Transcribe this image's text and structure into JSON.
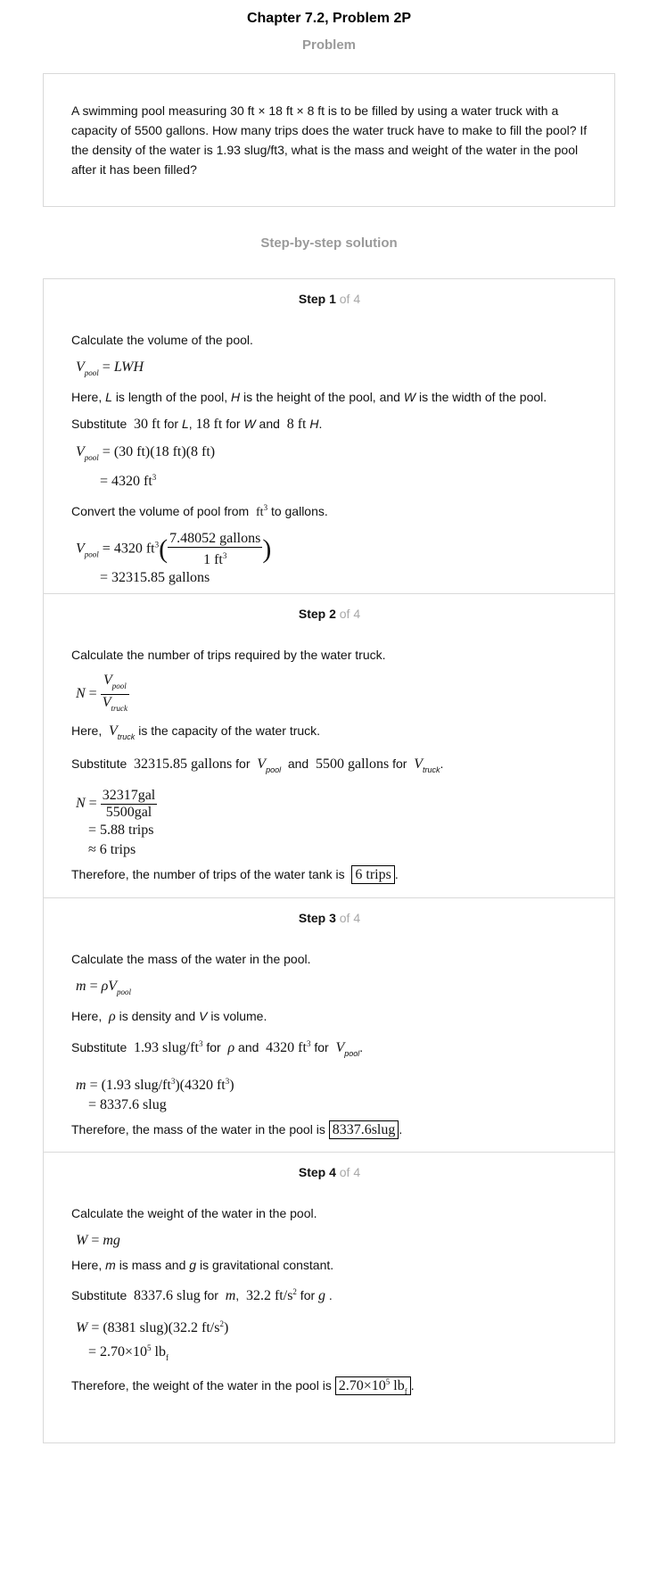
{
  "header": {
    "title": "Chapter 7.2, Problem 2P"
  },
  "problem": {
    "heading": "Problem",
    "text": "A swimming pool measuring 30 ft × 18 ft × 8 ft is to be filled by using a water truck with a capacity of 5500 gallons. How many trips does the water truck have to make to fill the pool? If the density of the water is 1.93 slug/ft3, what is the mass and weight of the water in the pool after it has been filled?"
  },
  "solution": {
    "heading": "Step-by-step solution"
  },
  "steps": [
    {
      "label": "Step 1",
      "of": "of 4",
      "intro": "Calculate the volume of the pool.",
      "here_text": "is length of the pool,",
      "here_text2": "is the height of the pool, and",
      "here_text3": "is the width of the pool.",
      "substitute": "Substitute",
      "convert": "Convert the volume of pool from",
      "convert_to": "to gallons."
    },
    {
      "label": "Step 2",
      "of": "of 4",
      "intro": "Calculate the number of trips required by the water truck.",
      "here_text": "is the capacity of the water truck.",
      "therefore": "Therefore, the number of trips of the water tank is",
      "answer": "6 trips"
    },
    {
      "label": "Step 3",
      "of": "of 4",
      "intro": "Calculate the mass of the water in the pool.",
      "here_text": "is density and",
      "here_text2": "is volume.",
      "therefore": "Therefore, the mass of the water in the pool is",
      "answer": "8337.6slug"
    },
    {
      "label": "Step 4",
      "of": "of 4",
      "intro": "Calculate the weight of the water in the pool.",
      "here_text": "is mass and",
      "here_text2": "is gravitational constant.",
      "therefore": "Therefore, the weight of the water in the pool is"
    }
  ]
}
